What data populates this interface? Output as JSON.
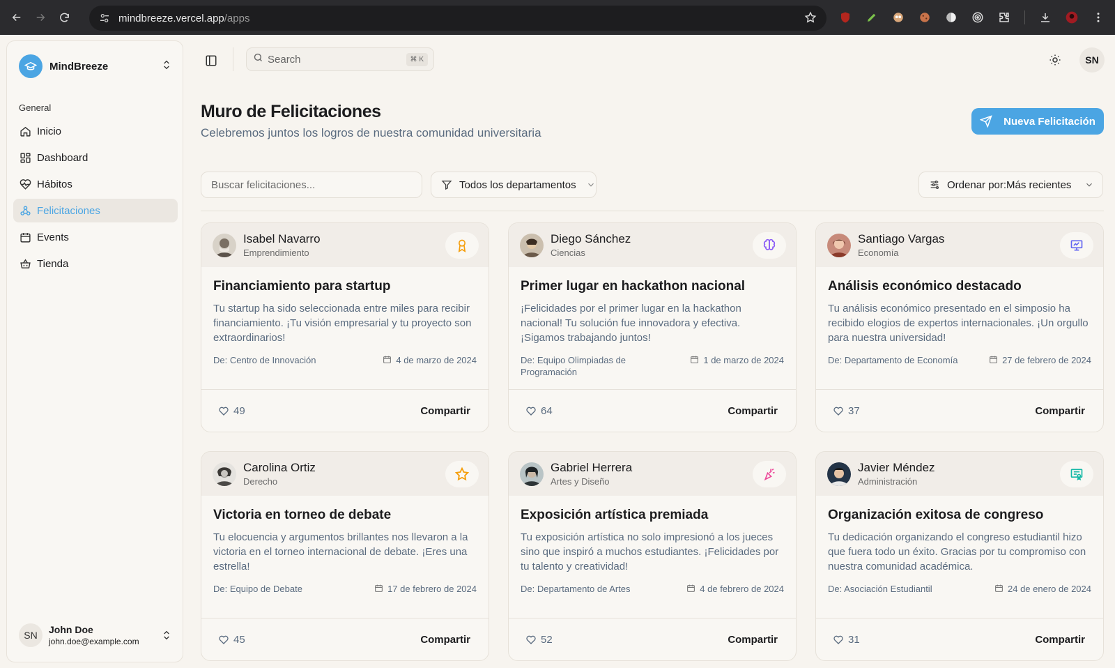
{
  "browser": {
    "url_host": "mindbreeze.vercel.app",
    "url_path": "/apps"
  },
  "sidebar": {
    "brand": "MindBreeze",
    "section_label": "General",
    "items": [
      {
        "label": "Inicio",
        "icon": "home-icon",
        "active": false
      },
      {
        "label": "Dashboard",
        "icon": "dashboard-icon",
        "active": false
      },
      {
        "label": "Hábitos",
        "icon": "heart-pulse-icon",
        "active": false
      },
      {
        "label": "Felicitaciones",
        "icon": "network-icon",
        "active": true
      },
      {
        "label": "Events",
        "icon": "calendar-icon",
        "active": false
      },
      {
        "label": "Tienda",
        "icon": "basket-icon",
        "active": false
      }
    ],
    "user": {
      "initials": "SN",
      "name": "John Doe",
      "email": "john.doe@example.com"
    }
  },
  "topbar": {
    "search_placeholder": "Search",
    "search_shortcut": "⌘ K",
    "avatar_initials": "SN"
  },
  "header": {
    "title": "Muro de Felicitaciones",
    "subtitle": "Celebremos juntos los logros de nuestra comunidad universitaria",
    "new_button": "Nueva Felicitación"
  },
  "filters": {
    "search_placeholder": "Buscar felicitaciones...",
    "department": "Todos los departamentos",
    "sort": "Ordenar por:Más recientes"
  },
  "colors": {
    "accent": "#4ba5e3",
    "background": "#f7f4ef"
  },
  "cards": [
    {
      "name": "Isabel Navarro",
      "department": "Emprendimiento",
      "badge_icon": "award-icon",
      "badge_color": "#f59e0b",
      "title": "Financiamiento para startup",
      "message": "Tu startup ha sido seleccionada entre miles para recibir financiamiento. ¡Tu visión empresarial y tu proyecto son extraordinarios!",
      "from": "De: Centro de Innovación",
      "date": "4 de marzo de 2024",
      "likes": "49",
      "share": "Compartir"
    },
    {
      "name": "Diego Sánchez",
      "department": "Ciencias",
      "badge_icon": "brain-icon",
      "badge_color": "#8b5cf6",
      "title": "Primer lugar en hackathon nacional",
      "message": "¡Felicidades por el primer lugar en la hackathon nacional! Tu solución fue innovadora y efectiva. ¡Sigamos trabajando juntos!",
      "from": "De: Equipo Olimpiadas de Programación",
      "date": "1 de marzo de 2024",
      "likes": "64",
      "share": "Compartir"
    },
    {
      "name": "Santiago Vargas",
      "department": "Economía",
      "badge_icon": "presentation-icon",
      "badge_color": "#6366f1",
      "title": "Análisis económico destacado",
      "message": "Tu análisis económico presentado en el simposio ha recibido elogios de expertos internacionales. ¡Un orgullo para nuestra universidad!",
      "from": "De: Departamento de Economía",
      "date": "27 de febrero de 2024",
      "likes": "37",
      "share": "Compartir"
    },
    {
      "name": "Carolina Ortiz",
      "department": "Derecho",
      "badge_icon": "star-icon",
      "badge_color": "#f59e0b",
      "title": "Victoria en torneo de debate",
      "message": "Tu elocuencia y argumentos brillantes nos llevaron a la victoria en el torneo internacional de debate. ¡Eres una estrella!",
      "from": "De: Equipo de Debate",
      "date": "17 de febrero de 2024",
      "likes": "45",
      "share": "Compartir"
    },
    {
      "name": "Gabriel Herrera",
      "department": "Artes y Diseño",
      "badge_icon": "party-popper-icon",
      "badge_color": "#ec4899",
      "title": "Exposición artística premiada",
      "message": "Tu exposición artística no solo impresionó a los jueces sino que inspiró a muchos estudiantes. ¡Felicidades por tu talento y creatividad!",
      "from": "De: Departamento de Artes",
      "date": "4 de febrero de 2024",
      "likes": "52",
      "share": "Compartir"
    },
    {
      "name": "Javier Méndez",
      "department": "Administración",
      "badge_icon": "certificate-icon",
      "badge_color": "#14b8a6",
      "title": "Organización exitosa de congreso",
      "message": "Tu dedicación organizando el congreso estudiantil hizo que fuera todo un éxito. Gracias por tu compromiso con nuestra comunidad académica.",
      "from": "De: Asociación Estudiantil",
      "date": "24 de enero de 2024",
      "likes": "31",
      "share": "Compartir"
    }
  ]
}
